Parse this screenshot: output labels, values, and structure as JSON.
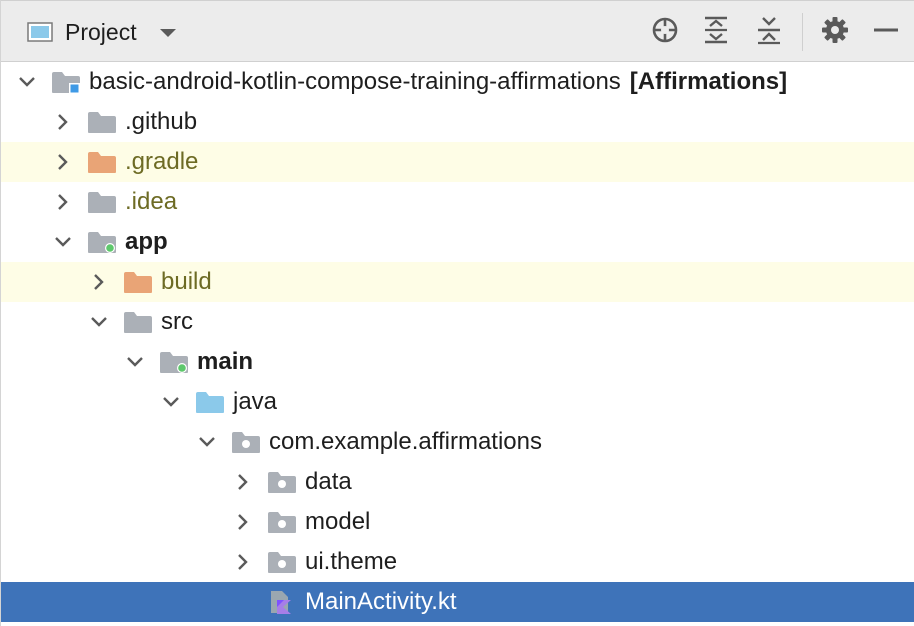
{
  "toolbar": {
    "view_label": "Project",
    "view_icon": "project-window-icon",
    "dropdown_icon": "chevron-down-icon",
    "buttons": [
      {
        "name": "locate-file-icon"
      },
      {
        "name": "expand-all-icon"
      },
      {
        "name": "collapse-all-icon"
      },
      {
        "name": "gear-icon"
      },
      {
        "name": "hide-icon"
      }
    ]
  },
  "tree": {
    "rows": [
      {
        "label": "basic-android-kotlin-compose-training-affirmations",
        "suffix": "[Affirmations]",
        "state": "expanded",
        "icon": "project-root-folder-icon",
        "style": "normal"
      },
      {
        "label": ".github",
        "state": "collapsed",
        "icon": "folder-icon",
        "style": "normal"
      },
      {
        "label": ".gradle",
        "state": "collapsed",
        "icon": "excluded-folder-icon",
        "style": "excluded"
      },
      {
        "label": ".idea",
        "state": "collapsed",
        "icon": "folder-icon",
        "style": "excluded-text"
      },
      {
        "label": "app",
        "state": "expanded",
        "icon": "module-folder-icon",
        "style": "bold"
      },
      {
        "label": "build",
        "state": "collapsed",
        "icon": "excluded-folder-icon",
        "style": "excluded"
      },
      {
        "label": "src",
        "state": "expanded",
        "icon": "folder-icon",
        "style": "normal"
      },
      {
        "label": "main",
        "state": "expanded",
        "icon": "source-set-folder-icon",
        "style": "bold"
      },
      {
        "label": "java",
        "state": "expanded",
        "icon": "source-root-folder-icon",
        "style": "normal"
      },
      {
        "label": "com.example.affirmations",
        "state": "expanded",
        "icon": "package-folder-icon",
        "style": "normal"
      },
      {
        "label": "data",
        "state": "collapsed",
        "icon": "package-folder-icon",
        "style": "normal"
      },
      {
        "label": "model",
        "state": "collapsed",
        "icon": "package-folder-icon",
        "style": "normal"
      },
      {
        "label": "ui.theme",
        "state": "collapsed",
        "icon": "package-folder-icon",
        "style": "normal"
      },
      {
        "label": "MainActivity.kt",
        "state": "leaf",
        "icon": "kotlin-file-icon",
        "style": "selected"
      }
    ]
  },
  "colors": {
    "toolbar_bg": "#ececec",
    "excluded_row_bg": "#fefde6",
    "selection_bg": "#3e73b9",
    "excluded_text": "#6d6b24",
    "excluded_folder": "#e9a476",
    "folder_gray": "#abb0b7",
    "source_root_blue": "#8bc9ea",
    "module_dot_green": "#5ec86c",
    "root_marker_blue": "#3f9ae6"
  }
}
